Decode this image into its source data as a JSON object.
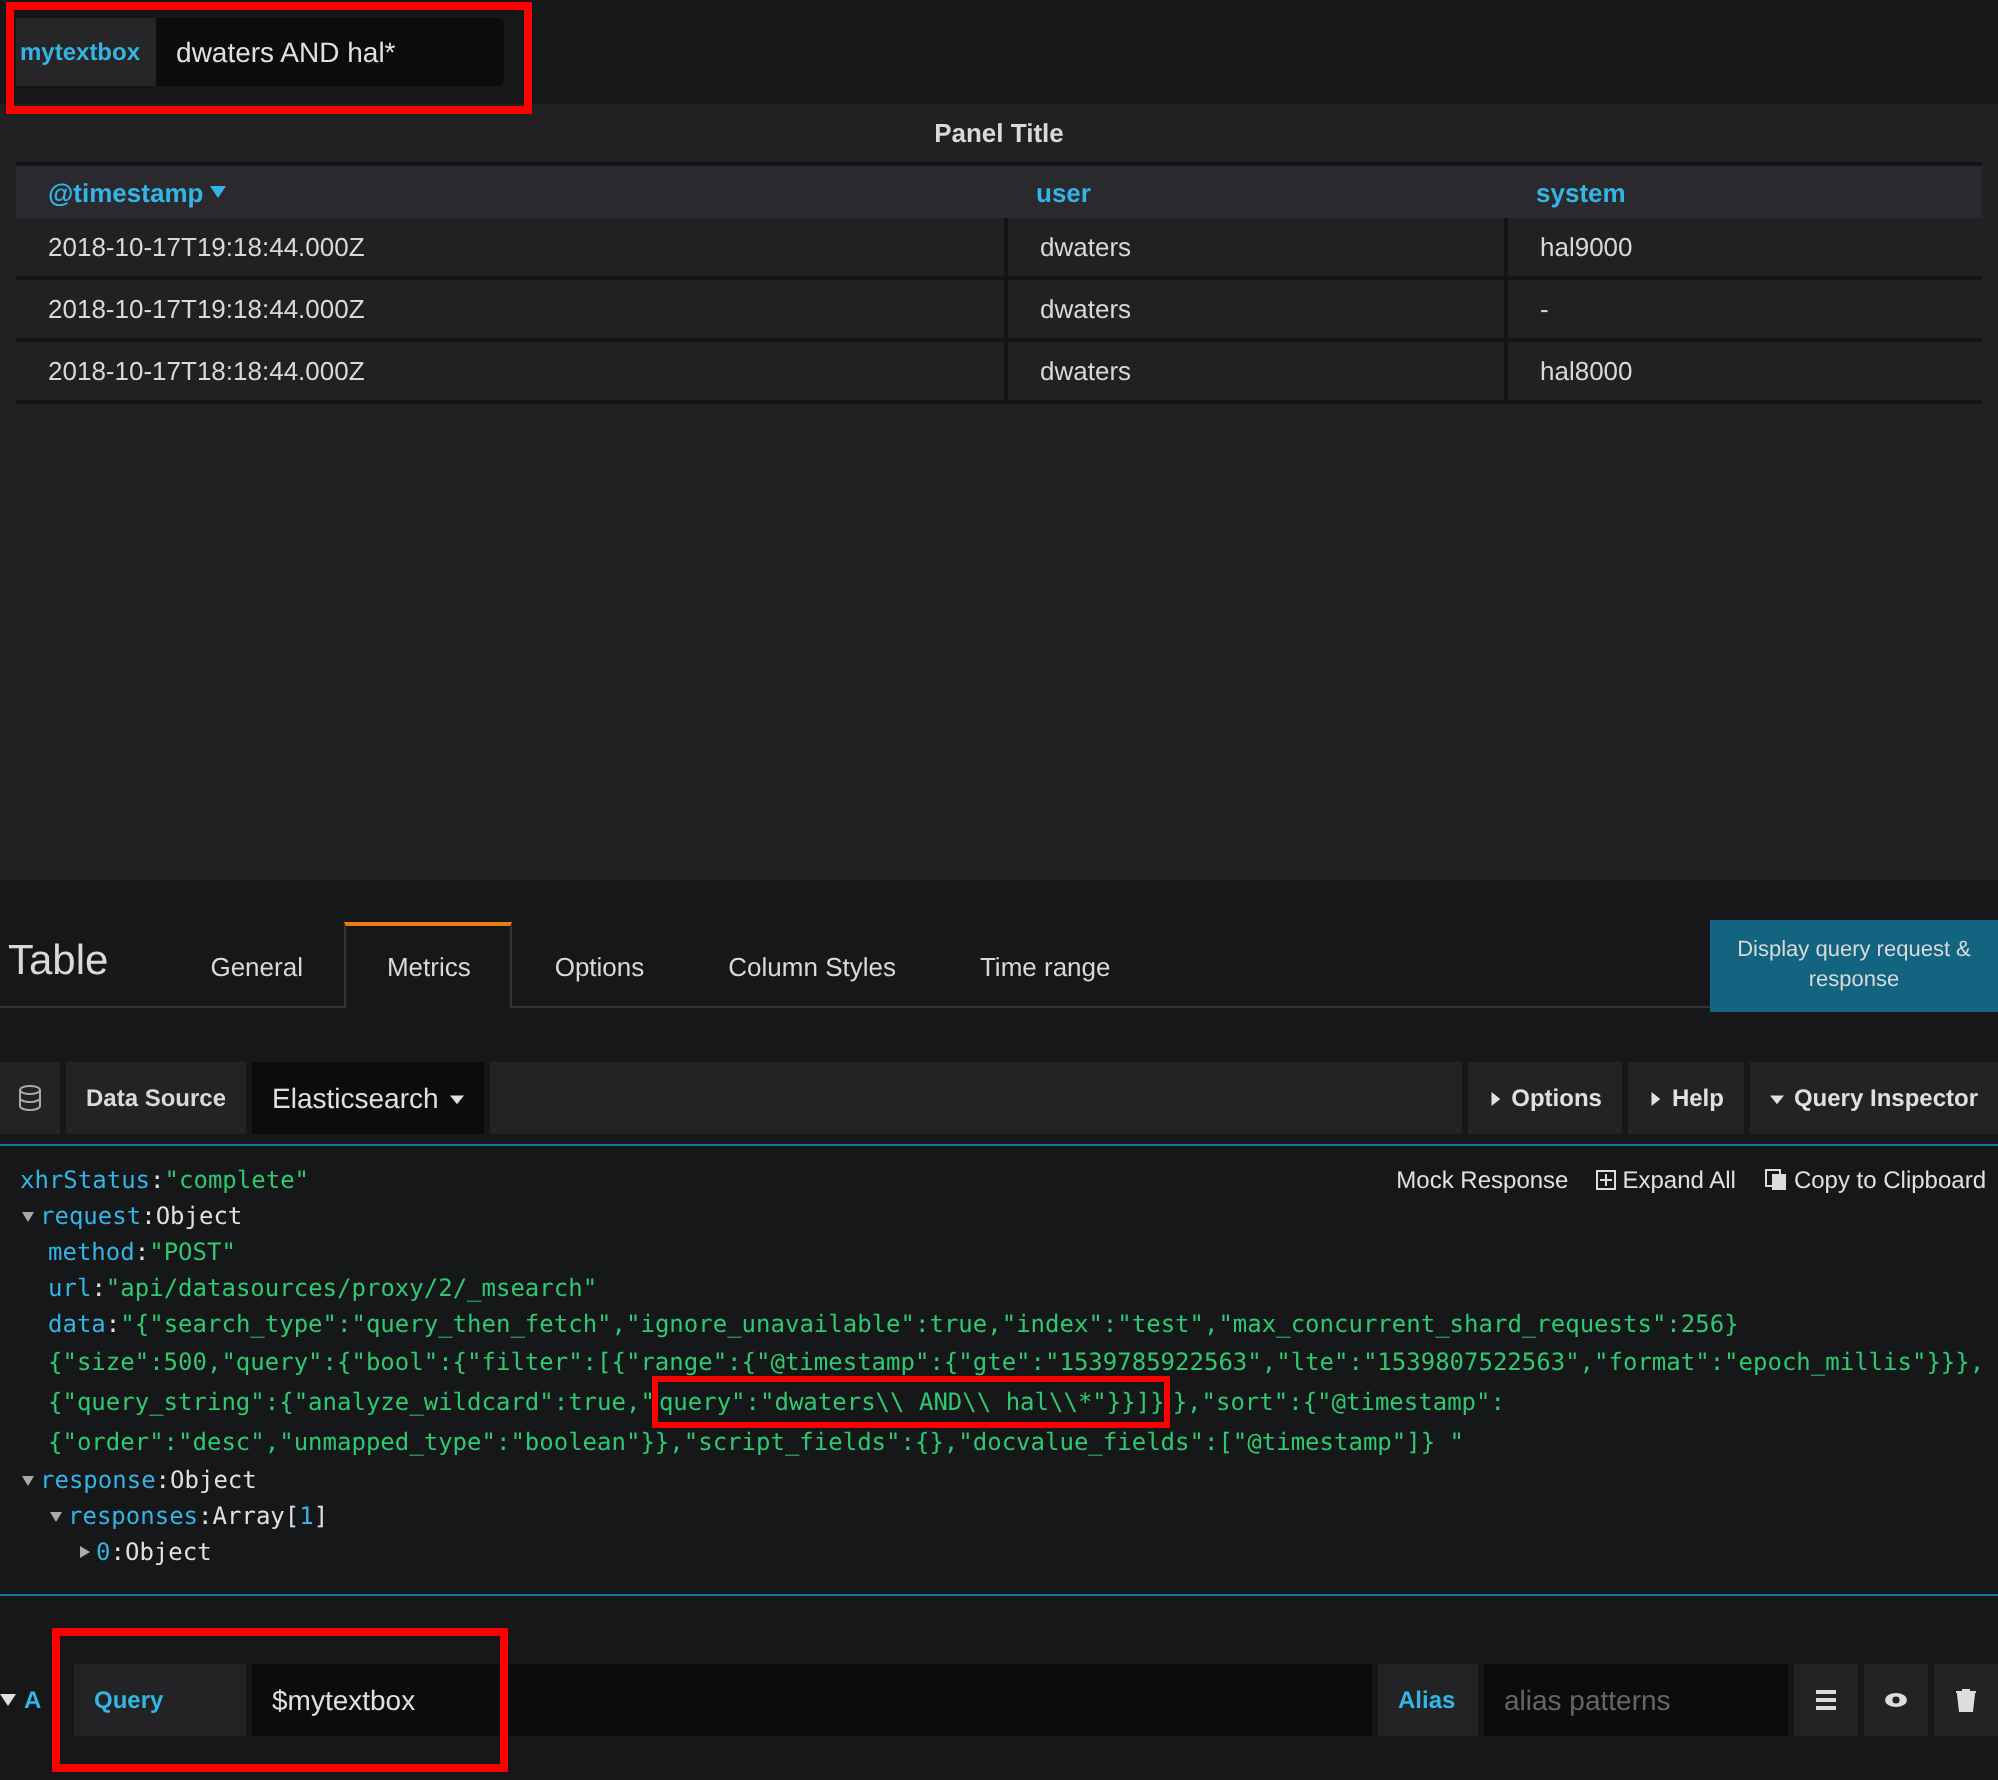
{
  "variable": {
    "label": "mytextbox",
    "value": "dwaters AND hal*",
    "highlighted": true
  },
  "panel": {
    "title": "Panel Title",
    "columns": [
      {
        "label": "@timestamp",
        "sorted": true
      },
      {
        "label": "user",
        "sorted": false
      },
      {
        "label": "system",
        "sorted": false
      }
    ],
    "rows": [
      [
        "2018-10-17T19:18:44.000Z",
        "dwaters",
        "hal9000"
      ],
      [
        "2018-10-17T19:18:44.000Z",
        "dwaters",
        "-"
      ],
      [
        "2018-10-17T18:18:44.000Z",
        "dwaters",
        "hal8000"
      ]
    ]
  },
  "editor": {
    "title": "Table",
    "tabs": [
      {
        "label": "General",
        "selected": false
      },
      {
        "label": "Metrics",
        "selected": true
      },
      {
        "label": "Options",
        "selected": false
      },
      {
        "label": "Column Styles",
        "selected": false
      },
      {
        "label": "Time range",
        "selected": false
      }
    ],
    "tooltip": "Display query request & response",
    "toolbar": {
      "data_source_label": "Data Source",
      "data_source": "Elasticsearch",
      "buttons": [
        {
          "label": "Options",
          "expanded": false
        },
        {
          "label": "Help",
          "expanded": false
        },
        {
          "label": "Query Inspector",
          "expanded": true
        }
      ]
    },
    "inspector_actions": [
      "Mock Response",
      "Expand All",
      "Copy to Clipboard"
    ],
    "inspector": [
      {
        "key": "xhrStatus",
        "sep": ":",
        "kind": "string",
        "value": "\"complete\""
      },
      {
        "key": "request",
        "sep": ":",
        "kind": "object",
        "value": "Object",
        "expanded": true,
        "children": [
          {
            "key": "method",
            "sep": ":",
            "kind": "string",
            "value": "\"POST\""
          },
          {
            "key": "url",
            "sep": ":",
            "kind": "string",
            "value": "\"api/datasources/proxy/2/_msearch\""
          },
          {
            "key": "data",
            "sep": ":",
            "kind": "string",
            "lines": [
              [
                {
                  "text": "\"{\"search_type\":\"query_then_fetch\",\"ignore_unavailable\":true,\"index\":\"test\",\"max_concurrent_shard_requests\":256}",
                  "highlighted": false
                }
              ],
              [
                {
                  "text": "{\"size\":500,\"query\":{\"bool\":{\"filter\":[{\"range\":{\"@timestamp\":{\"gte\":\"1539785922563\",\"lte\":\"1539807522563\",\"format\":\"epoch_millis\"}}},",
                  "highlighted": false
                }
              ],
              [
                {
                  "text": "{\"query_string\":{\"analyze_wildcard\":true,\"",
                  "highlighted": false
                },
                {
                  "text": "query\":\"dwaters\\\\ AND\\\\ hal\\\\*\"}}]}",
                  "highlighted": true
                },
                {
                  "text": "},\"sort\":{\"@timestamp\":",
                  "highlighted": false
                }
              ],
              [
                {
                  "text": "{\"order\":\"desc\",\"unmapped_type\":\"boolean\"}},\"script_fields\":{},\"docvalue_fields\":[\"@timestamp\"]} \"",
                  "highlighted": false
                }
              ]
            ]
          }
        ]
      },
      {
        "key": "response",
        "sep": ":",
        "kind": "object",
        "value": "Object",
        "expanded": true,
        "children": [
          {
            "key": "responses",
            "sep": ":",
            "kind": "array",
            "value": "Array[",
            "count": "1",
            "close": "]",
            "expanded": true,
            "children": [
              {
                "key": "0",
                "sep": ":",
                "kind": "object",
                "value": "Object",
                "expanded": false
              }
            ]
          }
        ]
      }
    ],
    "query_row": {
      "ref": "A",
      "label": "Query",
      "value": "$mytextbox",
      "highlighted": true,
      "alias_label": "Alias",
      "alias_placeholder": "alias patterns"
    }
  }
}
